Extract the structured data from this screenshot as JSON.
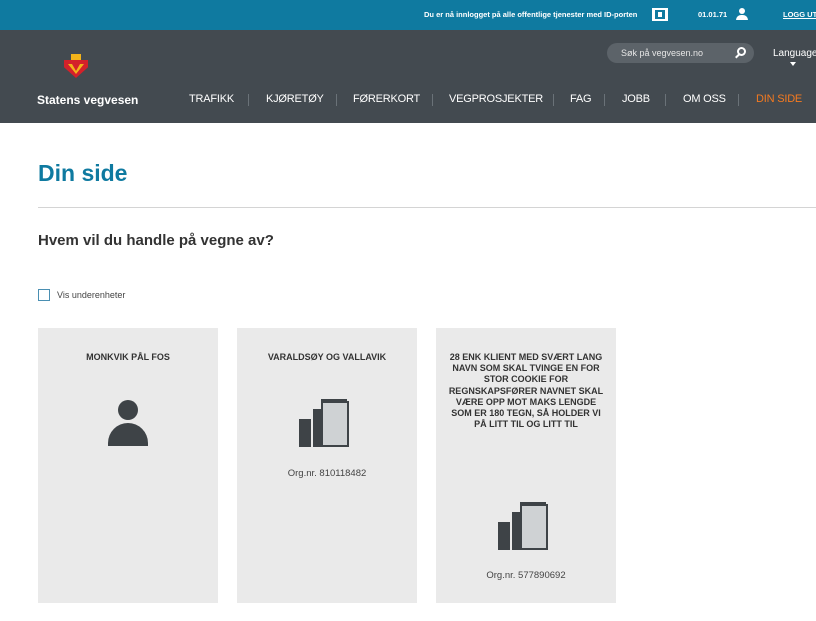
{
  "topbar": {
    "notice": "Du er nå innlogget på alle offentlige tjenester med ID-porten",
    "birthdate": "01.01.71",
    "logout_label": "LOGG UT"
  },
  "header": {
    "logo_text": "Statens vegvesen",
    "search_placeholder": "Søk på vegvesen.no",
    "language_label": "Language",
    "nav": [
      {
        "label": "TRAFIKK"
      },
      {
        "label": "KJØRETØY"
      },
      {
        "label": "FØRERKORT"
      },
      {
        "label": "VEGPROSJEKTER"
      },
      {
        "label": "FAG"
      },
      {
        "label": "JOBB"
      },
      {
        "label": "OM OSS"
      },
      {
        "label": "DIN SIDE",
        "active": true
      }
    ]
  },
  "main": {
    "title": "Din side",
    "subtitle": "Hvem vil du handle på vegne av?",
    "checkbox_label": "Vis underenheter",
    "checkbox_checked": false,
    "cards": [
      {
        "name": "MONKVIK PÅL FOS",
        "type": "person",
        "org": ""
      },
      {
        "name": "VARALDSØY OG VALLAVIK",
        "type": "organization",
        "org": "Org.nr. 810118482"
      },
      {
        "name": "28 ENK KLIENT MED SVÆRT LANG NAVN SOM SKAL TVINGE EN FOR STOR COOKIE FOR REGNSKAPSFØRER NAVNET SKAL VÆRE OPP MOT MAKS LENGDE SOM ER 180 TEGN, SÅ HOLDER VI PÅ LITT TIL OG LITT TIL",
        "type": "organization",
        "org": "Org.nr. 577890692"
      }
    ]
  },
  "colors": {
    "topbar": "#0f7aa0",
    "header": "#434a50",
    "accent": "#f47a20",
    "title": "#0f7aa0",
    "card": "#eaeaea"
  }
}
